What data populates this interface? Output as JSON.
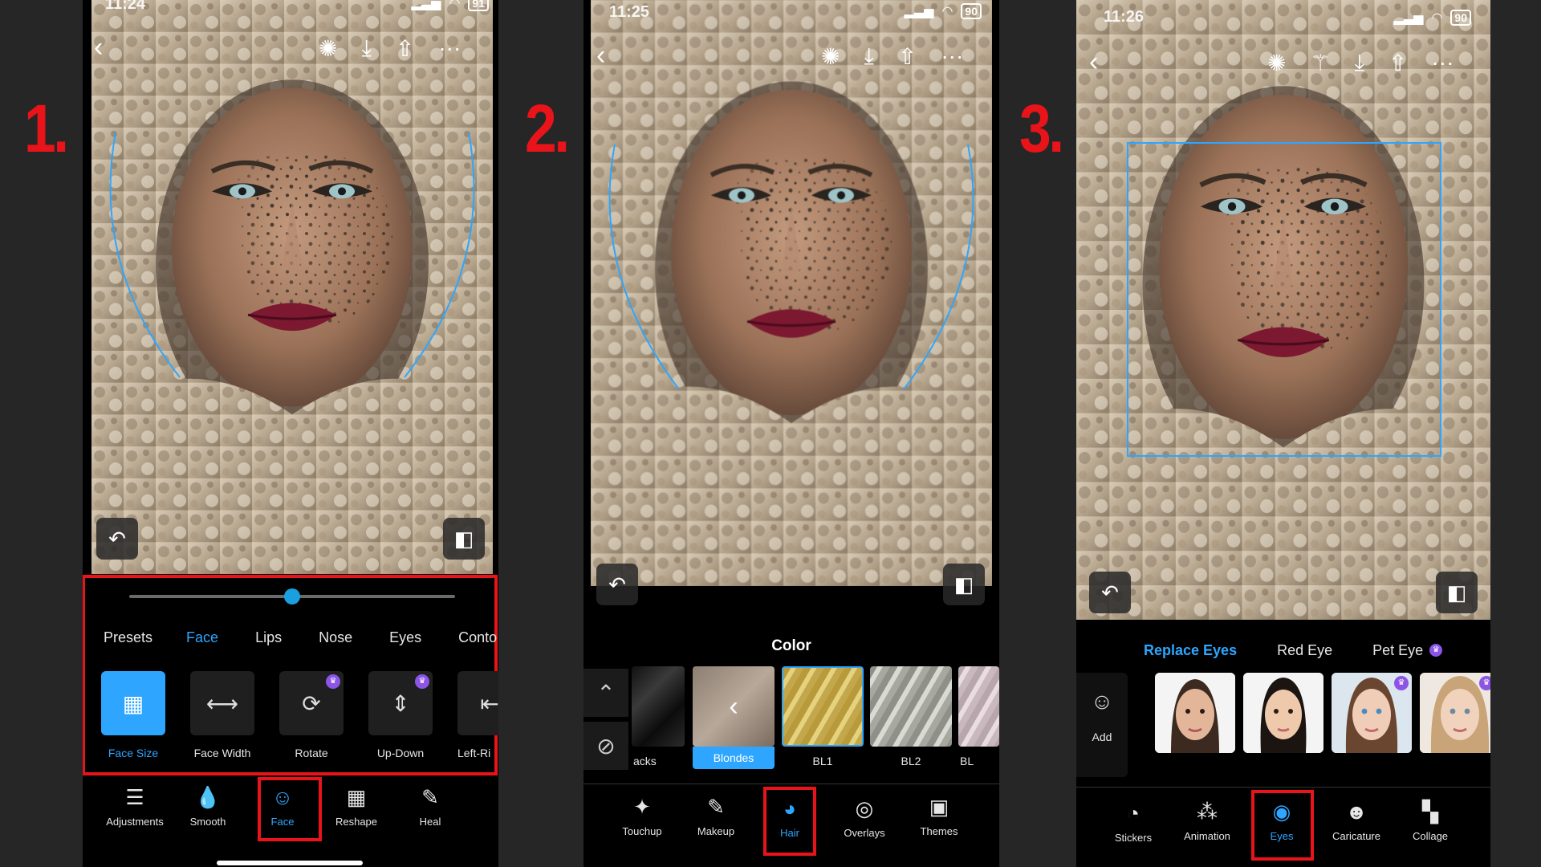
{
  "steps": [
    "1.",
    "2.",
    "3."
  ],
  "status": {
    "p1": {
      "time": "11:24",
      "battery": "91"
    },
    "p2": {
      "time": "11:25",
      "battery": "90"
    },
    "p3": {
      "time": "11:26",
      "battery": "90"
    }
  },
  "colors": {
    "accent": "#1a9fe0",
    "highlight": "#e8141a",
    "background": "#262626"
  },
  "phone1": {
    "slider_value": 0.5,
    "tabs": [
      "Presets",
      "Face",
      "Lips",
      "Nose",
      "Eyes",
      "Conto"
    ],
    "active_tab": "Face",
    "tools": [
      {
        "label": "Face Size",
        "icon": "grid-icon",
        "active": true
      },
      {
        "label": "Face Width",
        "icon": "width-icon"
      },
      {
        "label": "Rotate",
        "icon": "rotate-icon",
        "premium": true
      },
      {
        "label": "Up-Down",
        "icon": "up-down-icon",
        "premium": true
      },
      {
        "label": "Left-Ri",
        "icon": "left-right-icon"
      }
    ],
    "nav": [
      "Adjustments",
      "Smooth",
      "Face",
      "Reshape",
      "Heal"
    ],
    "active_nav": "Face"
  },
  "phone2": {
    "section_title": "Color",
    "swatches": [
      "acks",
      "Blondes",
      "BL1",
      "BL2",
      "BL"
    ],
    "nav": [
      "Touchup",
      "Makeup",
      "Hair",
      "Overlays",
      "Themes"
    ],
    "active_nav": "Hair"
  },
  "phone3": {
    "tabs": [
      "Replace Eyes",
      "Red Eye",
      "Pet Eye"
    ],
    "active_tab": "Replace Eyes",
    "add_label": "Add",
    "nav": [
      "Stickers",
      "Animation",
      "Eyes",
      "Caricature",
      "Collage"
    ],
    "active_nav": "Eyes"
  }
}
